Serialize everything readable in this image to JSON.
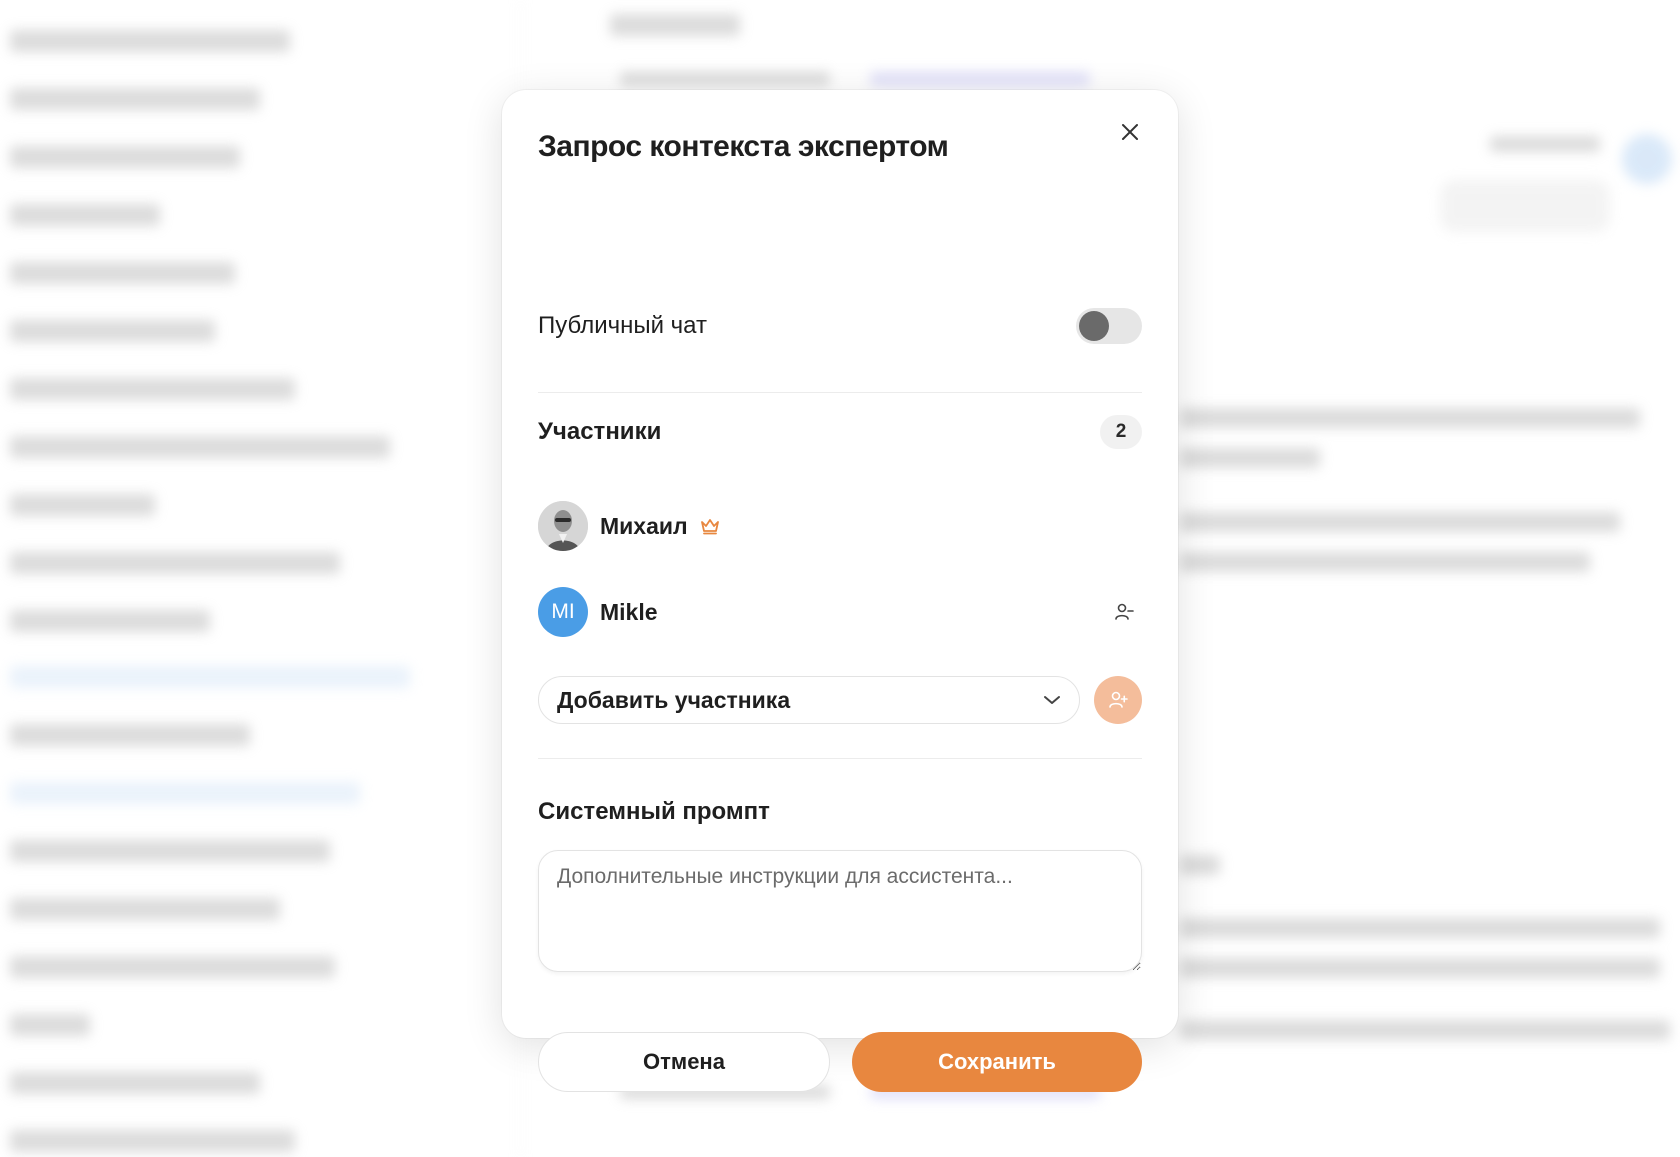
{
  "modal": {
    "title": "Запрос контекста экспертом",
    "public_chat_label": "Публичный чат",
    "public_chat_enabled": false,
    "participants_label": "Участники",
    "participants_count": "2",
    "participants": [
      {
        "name": "Михаил",
        "avatar": "photo",
        "role": "owner",
        "role_icon": "crown-icon"
      },
      {
        "name": "Mikle",
        "initials": "MI",
        "avatar_color": "#4a9de6",
        "action_icon": "user-remove-icon"
      }
    ],
    "add_participant_placeholder": "Добавить участника",
    "system_prompt_label": "Системный промпт",
    "system_prompt_placeholder": "Дополнительные инструкции для ассистента...",
    "cancel_label": "Отмена",
    "save_label": "Сохранить"
  },
  "colors": {
    "accent": "#e8873f",
    "accent_light": "#f4bd9b",
    "avatar_blue": "#4a9de6",
    "crown": "#e8873f"
  }
}
